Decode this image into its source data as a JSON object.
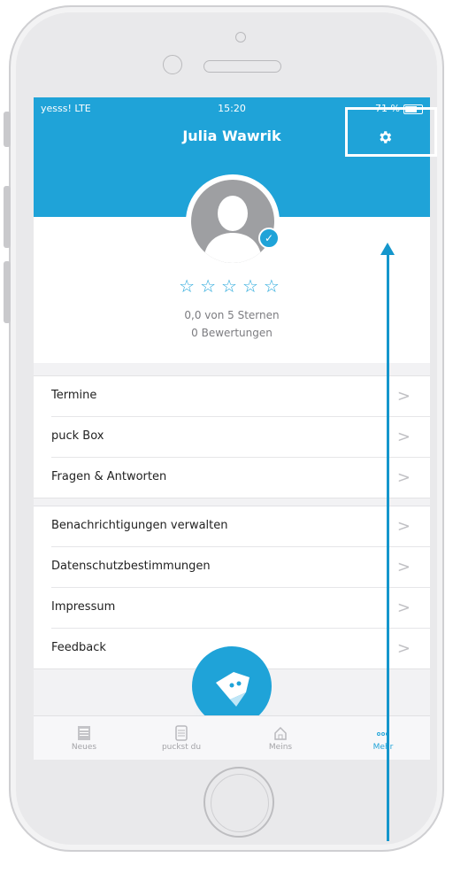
{
  "status_bar": {
    "carrier": "yesss!  LTE",
    "time": "15:20",
    "battery": "71 %"
  },
  "header": {
    "title": "Julia Wawrik"
  },
  "profile": {
    "stars": [
      "☆",
      "☆",
      "☆",
      "☆",
      "☆"
    ],
    "rating_text": "0,0 von 5 Sternen",
    "reviews_text": "0 Bewertungen"
  },
  "menu_group1": [
    {
      "label": "Termine"
    },
    {
      "label": "puck Box"
    },
    {
      "label": "Fragen & Antworten"
    }
  ],
  "menu_group2": [
    {
      "label": "Benachrichtigungen verwalten"
    },
    {
      "label": "Datenschutzbestimmungen"
    },
    {
      "label": "Impressum"
    },
    {
      "label": "Feedback"
    }
  ],
  "chevron": ">",
  "tabbar": [
    {
      "label": "Neues",
      "icon": "news-icon"
    },
    {
      "label": "puckst du",
      "icon": "list-icon"
    },
    {
      "label": "Meins",
      "icon": "home-icon"
    },
    {
      "label": "Mehr",
      "icon": "more-icon",
      "active": true
    }
  ],
  "colors": {
    "accent": "#1fa3d8",
    "arrow": "#1496cc"
  }
}
